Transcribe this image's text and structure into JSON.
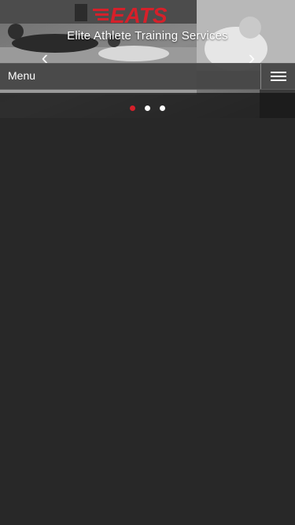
{
  "brand": {
    "logo_text": "EATS",
    "tagline": "Elite Athlete Training Services",
    "accent_color": "#d6202a"
  },
  "slider": {
    "prev_icon": "chevron-left-icon",
    "next_icon": "chevron-right-icon",
    "prev_glyph": "‹",
    "next_glyph": "›",
    "slide_count": 3,
    "active_slide": 1
  },
  "menu": {
    "label": "Menu",
    "toggle_icon": "hamburger-icon"
  }
}
